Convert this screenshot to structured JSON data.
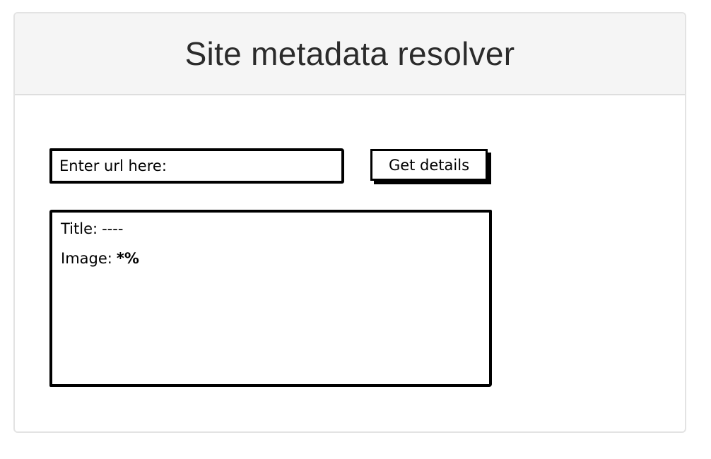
{
  "header": {
    "title": "Site metadata resolver"
  },
  "form": {
    "url_placeholder": "Enter url here:",
    "submit_label": "Get details"
  },
  "result": {
    "title_label": "Title:",
    "title_value": "----",
    "image_label": "Image:",
    "image_value": "*%"
  }
}
